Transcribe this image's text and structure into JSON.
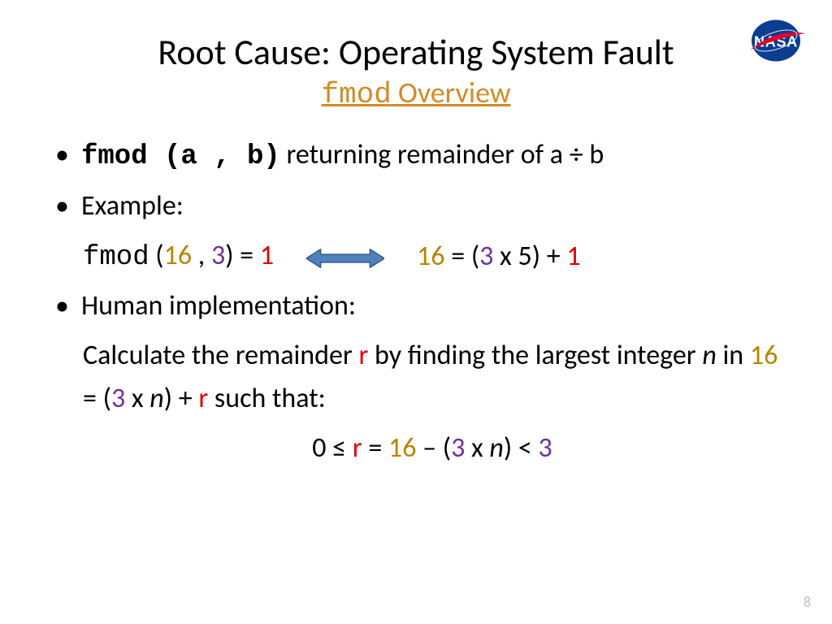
{
  "title": "Root Cause: Operating System Fault",
  "subtitle": {
    "mono": "fmod",
    "rest": " Overview"
  },
  "bullet1": {
    "sig": "fmod (a , b)",
    "desc": " returning remainder of a ÷ b"
  },
  "bullet2": "Example:",
  "example": {
    "fn": "fmod",
    "open": " (",
    "a": "16",
    "sep": " , ",
    "b": "3",
    "close": ") = ",
    "res": "1",
    "rhs_a": "16",
    "rhs_mid1": " = (",
    "rhs_b": "3",
    "rhs_mid2": " x 5) + ",
    "rhs_r": "1"
  },
  "bullet3": "Human implementation:",
  "human": {
    "p1a": "Calculate the remainder ",
    "r": "r",
    "p1b": " by finding the largest integer ",
    "n": "n",
    "p1c": " in ",
    "v16": "16",
    "p1d": " = (",
    "v3": "3",
    "p1e": " x ",
    "p1f": ") + ",
    "p1g": " such that:"
  },
  "ineq": {
    "a": "0 ≤   ",
    "r": "r",
    "b": " = ",
    "v16": "16",
    "c": " – (",
    "v3": "3",
    "d": " x ",
    "n": "n",
    "e": ")   < ",
    "v3b": "3"
  },
  "page": "8"
}
